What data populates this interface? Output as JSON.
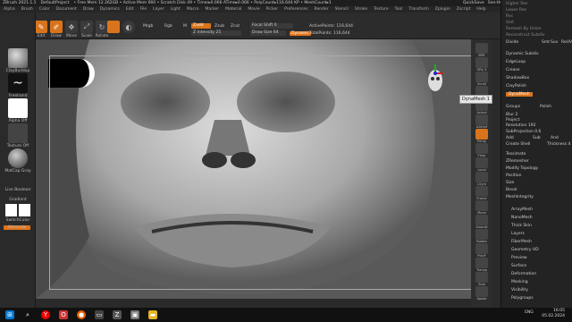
{
  "titlebar": {
    "app": "ZBrush 2021.1.1",
    "project": "DefaultProject",
    "mem": "• Free Mem 12.262GB • Active Mem 660 • Scratch Disk 49 • Timer▸0.066 ATime▸0.066 • PolyCount▸116.644 KP • MeshCount▸1",
    "quicksave": "QuickSave",
    "seethrough": "See-through 0",
    "menus": "Menus",
    "script": "DefaultZScript"
  },
  "menus": [
    "Alpha",
    "Brush",
    "Color",
    "Document",
    "Draw",
    "Dynamics",
    "Edit",
    "File",
    "Layer",
    "Light",
    "Macro",
    "Marker",
    "Material",
    "Movie",
    "Picker",
    "Preferences",
    "Render",
    "Stencil",
    "Stroke",
    "Texture",
    "Tool",
    "Transform",
    "Zplugin",
    "Zscript",
    "Help"
  ],
  "toolbar": {
    "dynamesh": "DynaMesh 1",
    "lightbox": "LightBox",
    "edit": "Edit",
    "draw": "Draw",
    "move": "Move",
    "scale": "Scale",
    "rotate": "Rotate",
    "mrgb": "Mrgb",
    "rgb": "Rgb",
    "m": "M",
    "zadd": "Zadd",
    "zsub": "Zsub",
    "zcut": "Zcut",
    "focal": "Focal Shift 0",
    "drawsize": "Draw Size 64",
    "intensity": "Z Intensity 25",
    "dynamic": "Dynamic",
    "active": "ActivePoints: 116,644",
    "total": "TotalPoints: 116,644"
  },
  "left": {
    "brush": "ClayBuildup",
    "stroke": "Freehand",
    "alpha": "Alpha Off",
    "texture": "Texture Off",
    "material": "MatCap Gray",
    "boxmode": "Live Boolean",
    "gradient": "Gradient",
    "switch": "SwitchColor",
    "alternate": "Alternate"
  },
  "shelf": [
    "BPR",
    "SPix 3",
    "Scroll",
    "Zoom",
    "Actual",
    "AAHalf",
    "Persp",
    "Floor",
    "Local",
    "LSym",
    "Frame",
    "Move",
    "ZoomD",
    "Rotate",
    "PolyF",
    "Transp",
    "Solo",
    "Xpose"
  ],
  "tooltip": "DynaMesh 1",
  "palette": {
    "top": [
      "Higher Res",
      "Lower Res",
      "Rec",
      "Smt",
      "Remesh By Union",
      "Reconstruct Subdiv"
    ],
    "items": [
      "Divide",
      "Smt",
      "Suv",
      "ReUV",
      "Dynamic Subdiv",
      "EdgeLoop",
      "Crease",
      "ShadowBox",
      "ClayPolish",
      "DynaMesh",
      "Groups",
      "Polish",
      "Blur 2",
      "Project",
      "Resolution 192",
      "SubProjection 0.6",
      "Add",
      "Sub",
      "And",
      "Create Shell",
      "Thickness 4",
      "Tessimate",
      "ZRemesher",
      "Modify Topology",
      "Position",
      "Size",
      "Bevel",
      "MeshIntegrity",
      "ArrayMesh",
      "NanoMesh",
      "Thick Skin",
      "Layers",
      "FiberMesh",
      "Geometry HD",
      "Preview",
      "Surface",
      "Deformation",
      "Masking",
      "Visibility",
      "Polygroups"
    ]
  },
  "taskbar": {
    "lang": "ENG",
    "time": "16:05",
    "date": "05.02.2024"
  },
  "colors": {
    "accent": "#d9741c"
  }
}
